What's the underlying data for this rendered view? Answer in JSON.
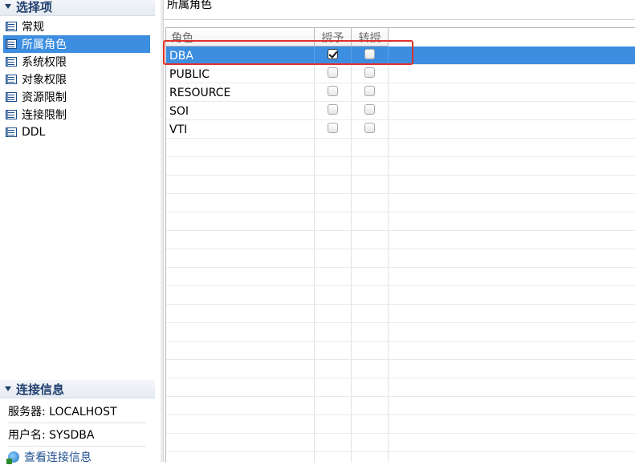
{
  "left": {
    "options_header": "选择项",
    "nav_items": [
      {
        "label": "常规",
        "icon": "page-icon",
        "selected": false
      },
      {
        "label": "所属角色",
        "icon": "page-icon",
        "selected": true
      },
      {
        "label": "系统权限",
        "icon": "page-icon",
        "selected": false
      },
      {
        "label": "对象权限",
        "icon": "page-icon",
        "selected": false
      },
      {
        "label": "资源限制",
        "icon": "page-icon",
        "selected": false
      },
      {
        "label": "连接限制",
        "icon": "page-icon",
        "selected": false
      },
      {
        "label": "DDL",
        "icon": "page-icon",
        "selected": false
      }
    ],
    "connection_header": "连接信息",
    "server": "服务器: LOCALHOST",
    "username": "用户名: SYSDBA",
    "view_link": "查看连接信息",
    "view_link_icon": "globe-icon"
  },
  "right": {
    "panel_title": "所属角色",
    "columns": [
      "角色",
      "授予",
      "转授"
    ],
    "rows": [
      {
        "role": "DBA",
        "grant": true,
        "admin": false,
        "selected": true
      },
      {
        "role": "PUBLIC",
        "grant": false,
        "admin": false,
        "selected": false
      },
      {
        "role": "RESOURCE",
        "grant": false,
        "admin": false,
        "selected": false
      },
      {
        "role": "SOI",
        "grant": false,
        "admin": false,
        "selected": false
      },
      {
        "role": "VTI",
        "grant": false,
        "admin": false,
        "selected": false
      }
    ],
    "empty_rows": 18
  },
  "colors": {
    "selection": "#3d8ee0",
    "highlight": "#e0312a",
    "header_text": "#1f3f6e"
  }
}
